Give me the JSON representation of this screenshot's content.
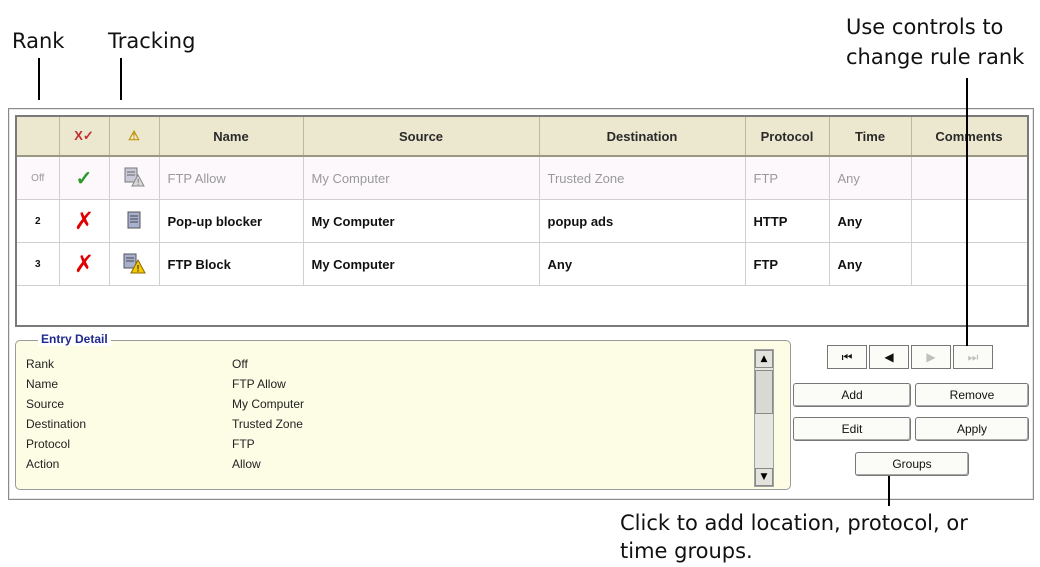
{
  "callouts": {
    "rank": "Rank",
    "tracking": "Tracking",
    "rank_controls_line1": "Use controls to",
    "rank_controls_line2": "change rule rank",
    "groups_line1": "Click to add location, protocol, or",
    "groups_line2": "time groups."
  },
  "table": {
    "headers": {
      "rank": "",
      "enabled": "X✓",
      "tracking": "⚠",
      "name": "Name",
      "source": "Source",
      "destination": "Destination",
      "protocol": "Protocol",
      "time": "Time",
      "comments": "Comments"
    },
    "rows": [
      {
        "rank": "Off",
        "action_icon": "check-icon",
        "tracking_icon": "log-alert-icon",
        "name": "FTP Allow",
        "source": "My Computer",
        "destination": "Trusted Zone",
        "protocol": "FTP",
        "time": "Any",
        "comments": ""
      },
      {
        "rank": "2",
        "action_icon": "block-x-icon",
        "tracking_icon": "log-icon",
        "name": "Pop-up blocker",
        "source": "My Computer",
        "destination": "popup ads",
        "protocol": "HTTP",
        "time": "Any",
        "comments": ""
      },
      {
        "rank": "3",
        "action_icon": "block-x-icon",
        "tracking_icon": "log-alert-icon",
        "name": "FTP Block",
        "source": "My Computer",
        "destination": "Any",
        "protocol": "FTP",
        "time": "Any",
        "comments": ""
      }
    ]
  },
  "entry_detail": {
    "title": "Entry Detail",
    "rows": [
      {
        "label": "Rank",
        "value": "Off"
      },
      {
        "label": "Name",
        "value": "FTP Allow"
      },
      {
        "label": "Source",
        "value": "My Computer"
      },
      {
        "label": "Destination",
        "value": "Trusted Zone"
      },
      {
        "label": "Protocol",
        "value": "FTP"
      },
      {
        "label": "Action",
        "value": "Allow"
      }
    ]
  },
  "buttons": {
    "first": "⏮",
    "prev": "◀",
    "next": "▶",
    "last": "⏭",
    "add": "Add",
    "remove": "Remove",
    "edit": "Edit",
    "apply": "Apply",
    "groups": "Groups"
  },
  "colors": {
    "header_bg": "#ece7cf",
    "detail_bg": "#fdfde6",
    "allow_check": "#2a9a2a",
    "block_x": "#e00000",
    "legend_text": "#1f2a8c"
  }
}
